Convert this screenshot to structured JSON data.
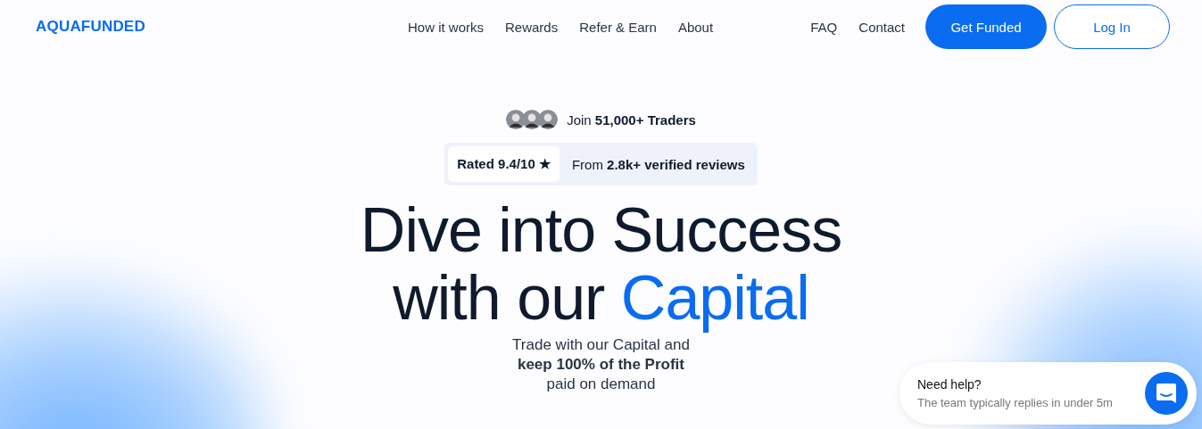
{
  "brand": {
    "logo": "AQUAFUNDED"
  },
  "nav": {
    "links": [
      "How it works",
      "Rewards",
      "Refer & Earn",
      "About"
    ],
    "secondary_links": [
      "FAQ",
      "Contact"
    ],
    "primary_button": "Get Funded",
    "secondary_button": "Log In"
  },
  "hero": {
    "social_proof": "Join **51,000+ Traders**",
    "rating": "Rated 9.4/10 ★",
    "reviews": "From **2.8k+ verified reviews**",
    "headline_line_1": "Dive into Success",
    "headline_line_2": "with our",
    "headline_highlight": "Capital",
    "subtitle_lines": [
      "Trade with our Capital and",
      "**keep 100% of the Profit**",
      "paid on demand"
    ]
  },
  "chat_widget": {
    "title": "Need help?",
    "subtitle": "The team typically replies in under 5m"
  }
}
